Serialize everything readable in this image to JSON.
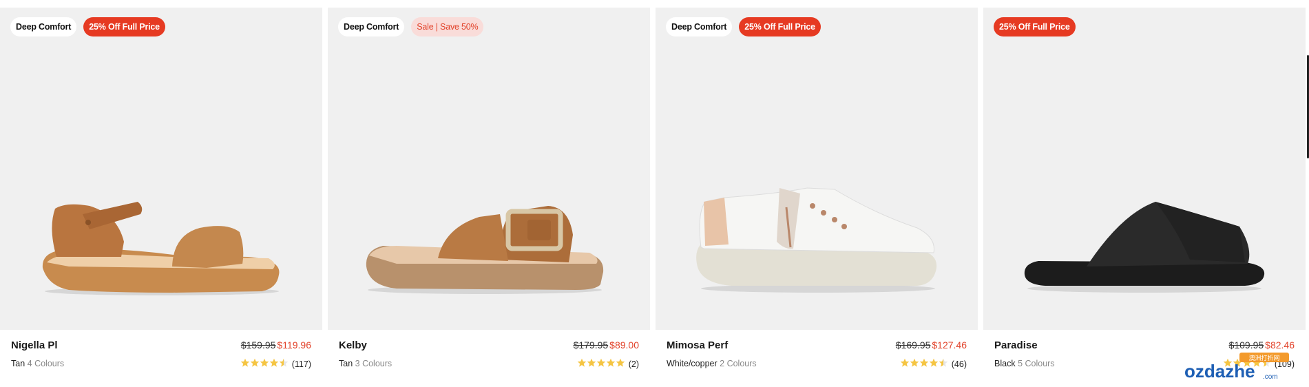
{
  "products": [
    {
      "name": "Nigella Pl",
      "badges": [
        "Deep Comfort",
        "25% Off Full Price"
      ],
      "old_price": "$159.95",
      "new_price": "$119.96",
      "color": "Tan",
      "colours": "4 Colours",
      "rating": 4.5,
      "reviews": "(117)"
    },
    {
      "name": "Kelby",
      "badges": [
        "Deep Comfort",
        "Sale | Save 50%"
      ],
      "old_price": "$179.95",
      "new_price": "$89.00",
      "color": "Tan",
      "colours": "3 Colours",
      "rating": 5,
      "reviews": "(2)"
    },
    {
      "name": "Mimosa Perf",
      "badges": [
        "Deep Comfort",
        "25% Off Full Price"
      ],
      "old_price": "$169.95",
      "new_price": "$127.46",
      "color": "White/copper",
      "colours": "2 Colours",
      "rating": 4.5,
      "reviews": "(46)"
    },
    {
      "name": "Paradise",
      "badges": [
        "25% Off Full Price"
      ],
      "old_price": "$109.95",
      "new_price": "$82.46",
      "color": "Black",
      "colours": "5 Colours",
      "rating": 4.5,
      "reviews": "(109)"
    }
  ],
  "watermark": {
    "text": "ozdazhe",
    "sub": ".com",
    "cn": "澳洲打折网"
  },
  "colors": {
    "promo": "#e63a22",
    "sale_bg": "#f9dcd9",
    "price_new": "#e2432b",
    "star": "#f5c543",
    "image_bg": "#f0f0f0"
  },
  "icons": [
    "star-icon",
    "half-star-icon"
  ]
}
